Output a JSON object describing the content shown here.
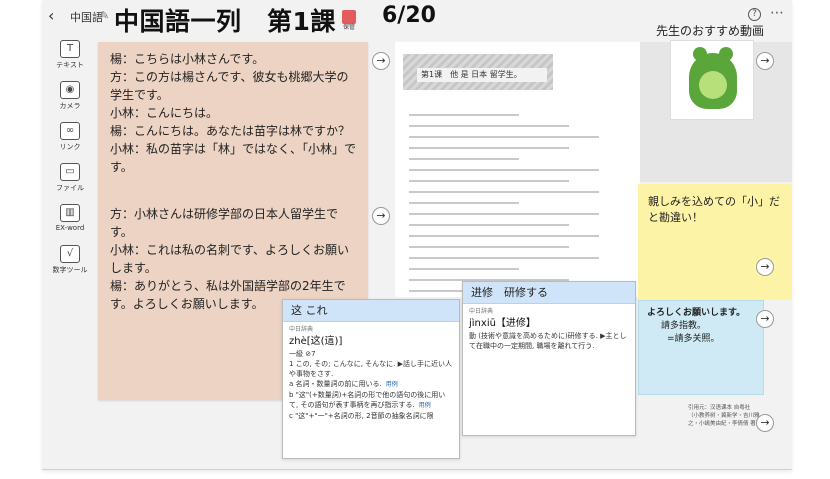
{
  "header": {
    "back_icon": "chevron-left-icon",
    "folder": "中国語",
    "title": "中国語一列　第1課",
    "save_badge": "保管",
    "page_indicator": "6/20",
    "recommend_label": "先生のおすすめ動画"
  },
  "tools": [
    {
      "label": "テキスト",
      "icon": "text-icon",
      "glyph": "T"
    },
    {
      "label": "カメラ",
      "icon": "camera-icon",
      "glyph": "◉"
    },
    {
      "label": "リンク",
      "icon": "link-icon",
      "glyph": "∞"
    },
    {
      "label": "ファイル",
      "icon": "file-icon",
      "glyph": "▭"
    },
    {
      "label": "EX-word",
      "icon": "dictionary-icon",
      "glyph": "▥"
    },
    {
      "label": "数字ツール",
      "icon": "math-tool-icon",
      "glyph": "√"
    }
  ],
  "textbook": {
    "lesson_heading": "第1课　他 是 日本 留学生。"
  },
  "notes": {
    "dialogue1": [
      "楊：こちらは小林さんです。",
      "方：この方は楊さんです、彼女も桃郷大学の学生です。",
      "小林：こんにちは。",
      "楊：こんにちは。あなたは苗字は林ですか？",
      "小林：私の苗字は「林」ではなく、「小林」です。"
    ],
    "dialogue2": [
      "方：小林さんは研修学部の日本人留学生です。",
      "小林：これは私の名刺です、よろしくお願いします。",
      "楊：ありがとう、私は外国語学部の2年生です。よろしくお願いします。"
    ],
    "yellow_note": "親しみを込めての「小」だと勘違い！",
    "cyan_note": [
      "よろしくお願いします。",
      "請多指教。",
      "=請多关照。"
    ]
  },
  "dict1": {
    "header": "这 これ",
    "source": "中日辞典",
    "word": "zhè[这(這)]",
    "meta": "一級 ⊘7",
    "lines": [
      "1 この, その; こんなに, そんなに. ▶話し手に近い人や事物をさす.",
      "a 名詞・数量詞の前に用いる.",
      "b \"这\"(+数量詞)+名詞の形で他の語句の後に用いて, その語句が表す事柄を再び指示する.",
      "c \"这\"+\"一\"+名詞の形, 2音節の抽象名詞に限"
    ],
    "example_tag": "用例"
  },
  "dict2": {
    "header": "进修　研修する",
    "source": "中日辞典",
    "word": "jìnxiū【进修】",
    "lines": [
      "動 (技術や意識を高めるために)研修する. ▶主として在職中の一定期間, 職場を離れて行う."
    ]
  },
  "credit": "引用元：汉语课本 自粤社（小教养树・冀新学・吉川雅之・小嶋美由紀・李倩倩 著）"
}
